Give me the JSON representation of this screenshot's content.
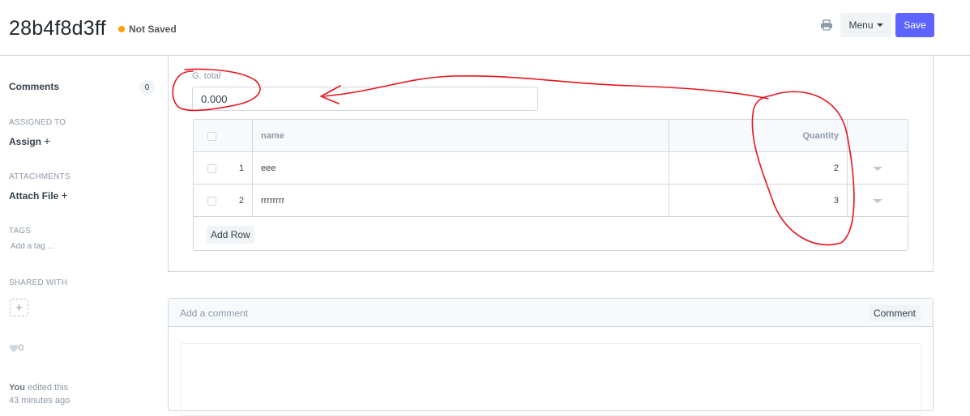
{
  "header": {
    "doc_title": "28b4f8d3ff",
    "status_text": "Not Saved",
    "status_color": "#ffa00a",
    "print_icon": "printer-icon",
    "menu_label": "Menu",
    "save_label": "Save",
    "accent_color": "#5e64ff"
  },
  "sidebar": {
    "comments_label": "Comments",
    "comments_count": "0",
    "assigned_to_label": "ASSIGNED TO",
    "assign_label": "Assign",
    "attachments_label": "ATTACHMENTS",
    "attach_label": "Attach File",
    "tags_label": "TAGS",
    "tag_placeholder": "Add a tag ...",
    "shared_with_label": "SHARED WITH",
    "likes_count": "0",
    "activity_user": "You",
    "activity_action": " edited this",
    "activity_time": "43 minutes ago"
  },
  "form": {
    "gtotal_label": "G. total",
    "gtotal_value": "0.000",
    "table": {
      "headers": {
        "name": "name",
        "quantity": "Quantity"
      },
      "rows": [
        {
          "idx": "1",
          "name": "eee",
          "quantity": "2"
        },
        {
          "idx": "2",
          "name": "rrrrrrrr",
          "quantity": "3"
        }
      ],
      "add_row_label": "Add Row"
    }
  },
  "comment": {
    "placeholder": "Add a comment",
    "button_label": "Comment"
  },
  "annotation_color": "#e8141c"
}
